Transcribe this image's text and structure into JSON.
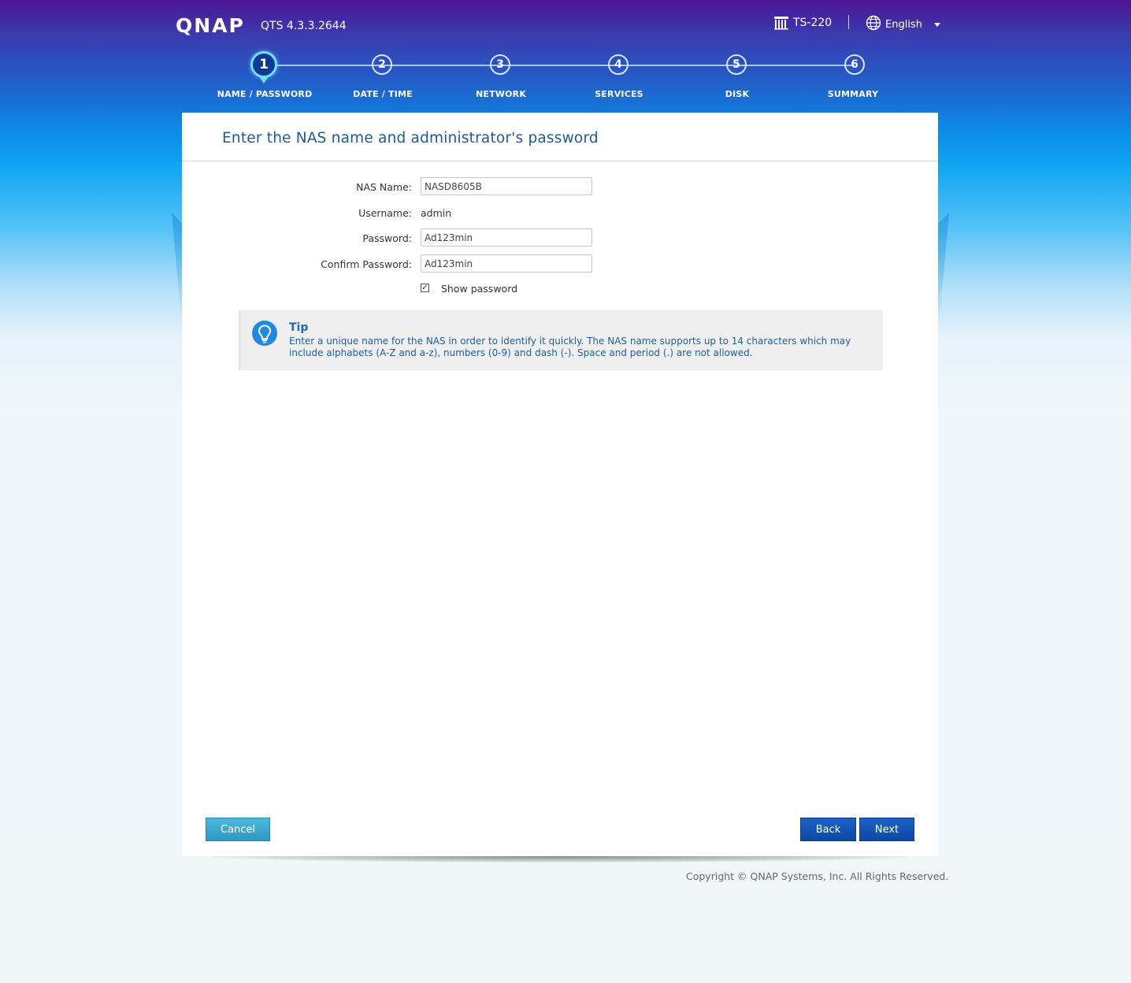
{
  "header": {
    "logo": "QNAP",
    "version": "QTS 4.3.3.2644",
    "model": "TS-220",
    "language": "English"
  },
  "steps": [
    {
      "number": "1",
      "label": "NAME / PASSWORD",
      "active": true
    },
    {
      "number": "2",
      "label": "DATE / TIME",
      "active": false
    },
    {
      "number": "3",
      "label": "NETWORK",
      "active": false
    },
    {
      "number": "4",
      "label": "SERVICES",
      "active": false
    },
    {
      "number": "5",
      "label": "DISK",
      "active": false
    },
    {
      "number": "6",
      "label": "SUMMARY",
      "active": false
    }
  ],
  "page": {
    "title": "Enter the NAS name and administrator's password"
  },
  "form": {
    "nas_name_label": "NAS Name:",
    "nas_name_value": "NASD8605B",
    "username_label": "Username:",
    "username_value": "admin",
    "password_label": "Password:",
    "password_value": "Ad123min",
    "confirm_label": "Confirm Password:",
    "confirm_value": "Ad123min",
    "show_password_label": "Show password",
    "show_password_checked": true
  },
  "tip": {
    "title": "Tip",
    "text": "Enter a unique name for the NAS in order to identify it quickly. The NAS name supports up to 14 characters which may include alphabets (A-Z and a-z), numbers (0-9) and dash (-). Space and period (.) are not allowed."
  },
  "buttons": {
    "cancel": "Cancel",
    "back": "Back",
    "next": "Next"
  },
  "footer": {
    "copyright": "Copyright © QNAP Systems, Inc. All Rights Reserved."
  },
  "colors": {
    "title_blue": "#1e5a96",
    "tip_blue": "#1a6bb8",
    "button_blue": "#0e47a4",
    "cancel_teal": "#2b97c4"
  }
}
